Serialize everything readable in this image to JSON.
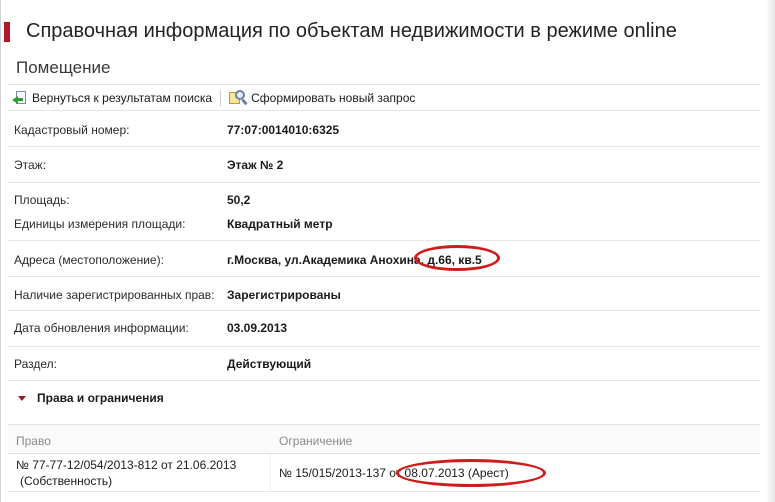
{
  "header": {
    "title": "Справочная информация по объектам недвижимости в режиме online",
    "section": "Помещение"
  },
  "toolbar": {
    "back_label": "Вернуться к результатам поиска",
    "new_query_label": "Сформировать новый запрос"
  },
  "properties": [
    {
      "label": "Кадастровый номер:",
      "value": "77:07:0014010:6325"
    },
    {
      "label": "Этаж:",
      "value": "Этаж № 2"
    },
    {
      "label": "Площадь:",
      "value": "50,2"
    },
    {
      "label": "Единицы измерения площади:",
      "value": "Квадратный метр"
    },
    {
      "label": "Адреса (местоположение):",
      "value": "г.Москва, ул.Академика Анохина, д.66, кв.5"
    },
    {
      "label": "Наличие зарегистрированных прав:",
      "value": "Зарегистрированы"
    },
    {
      "label": "Дата обновления информации:",
      "value": "03.09.2013"
    },
    {
      "label": "Раздел:",
      "value": "Действующий"
    }
  ],
  "rights": {
    "section_title": "Права и ограничения",
    "columns": [
      "Право",
      "Ограничение"
    ],
    "rows": [
      {
        "right_line1": "№ 77-77-12/054/2013-812  от 21.06.2013",
        "right_line2": "(Собственность)",
        "restriction": "№ 15/015/2013-137  от 08.07.2013  (Арест)"
      }
    ]
  },
  "colors": {
    "accent": "#b3172a",
    "annotation": "#d01b1b"
  }
}
